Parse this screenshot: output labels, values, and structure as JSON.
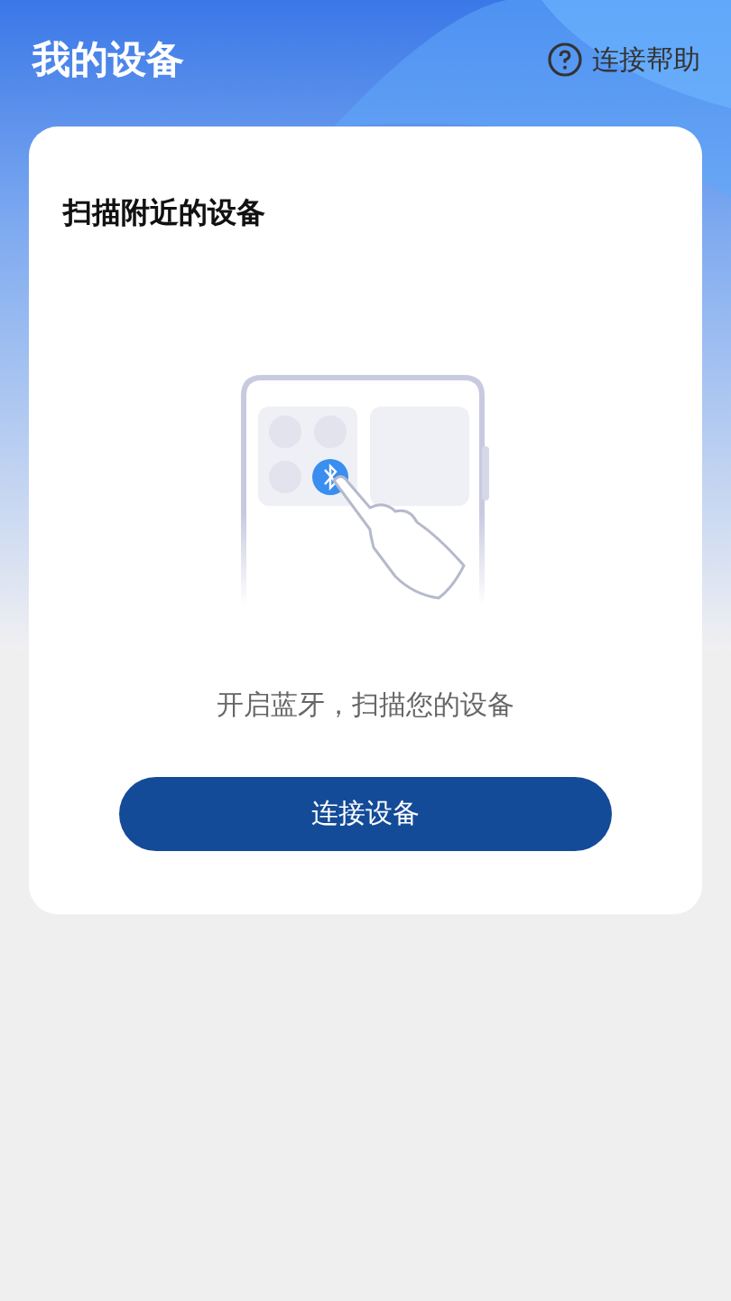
{
  "header": {
    "title": "我的设备",
    "help_link": "连接帮助"
  },
  "card": {
    "title": "扫描附近的设备",
    "hint": "开启蓝牙，扫描您的设备",
    "button": "连接设备"
  }
}
